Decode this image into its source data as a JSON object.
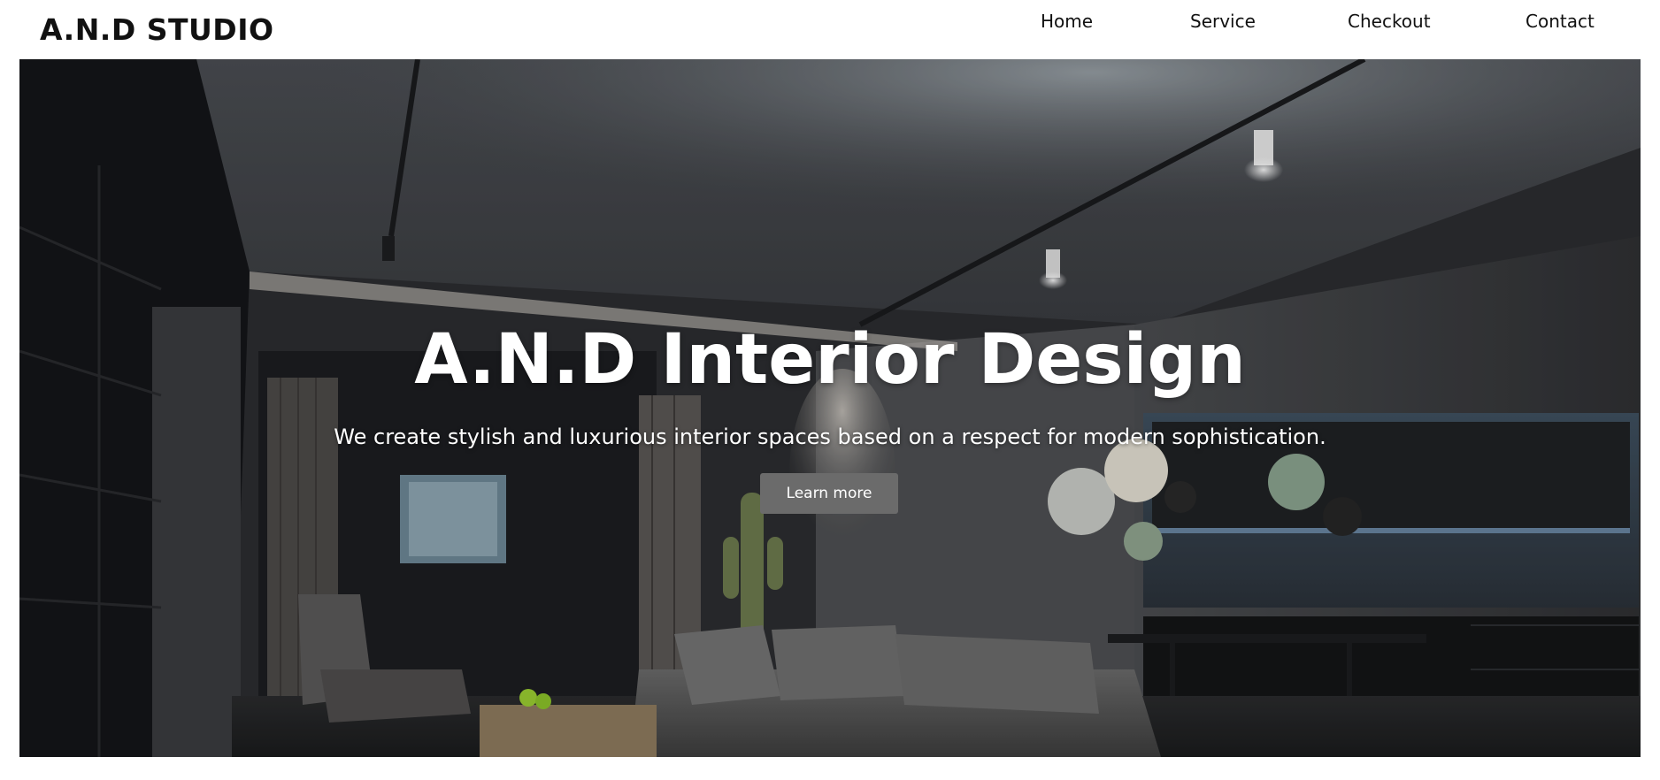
{
  "header": {
    "logo": "A.N.D STUDIO",
    "nav": [
      {
        "label": "Home"
      },
      {
        "label": "Service"
      },
      {
        "label": "Checkout"
      },
      {
        "label": "Contact"
      }
    ]
  },
  "hero": {
    "title": "A.N.D Interior Design",
    "subtitle": "We create stylish and luxurious interior spaces based on a respect for modern sophistication.",
    "button_label": "Learn more",
    "background_image": "dark-modern-living-room-photo"
  },
  "colors": {
    "text_dark": "#111111",
    "button_bg": "#6b6b6b",
    "hero_text": "#ffffff"
  }
}
